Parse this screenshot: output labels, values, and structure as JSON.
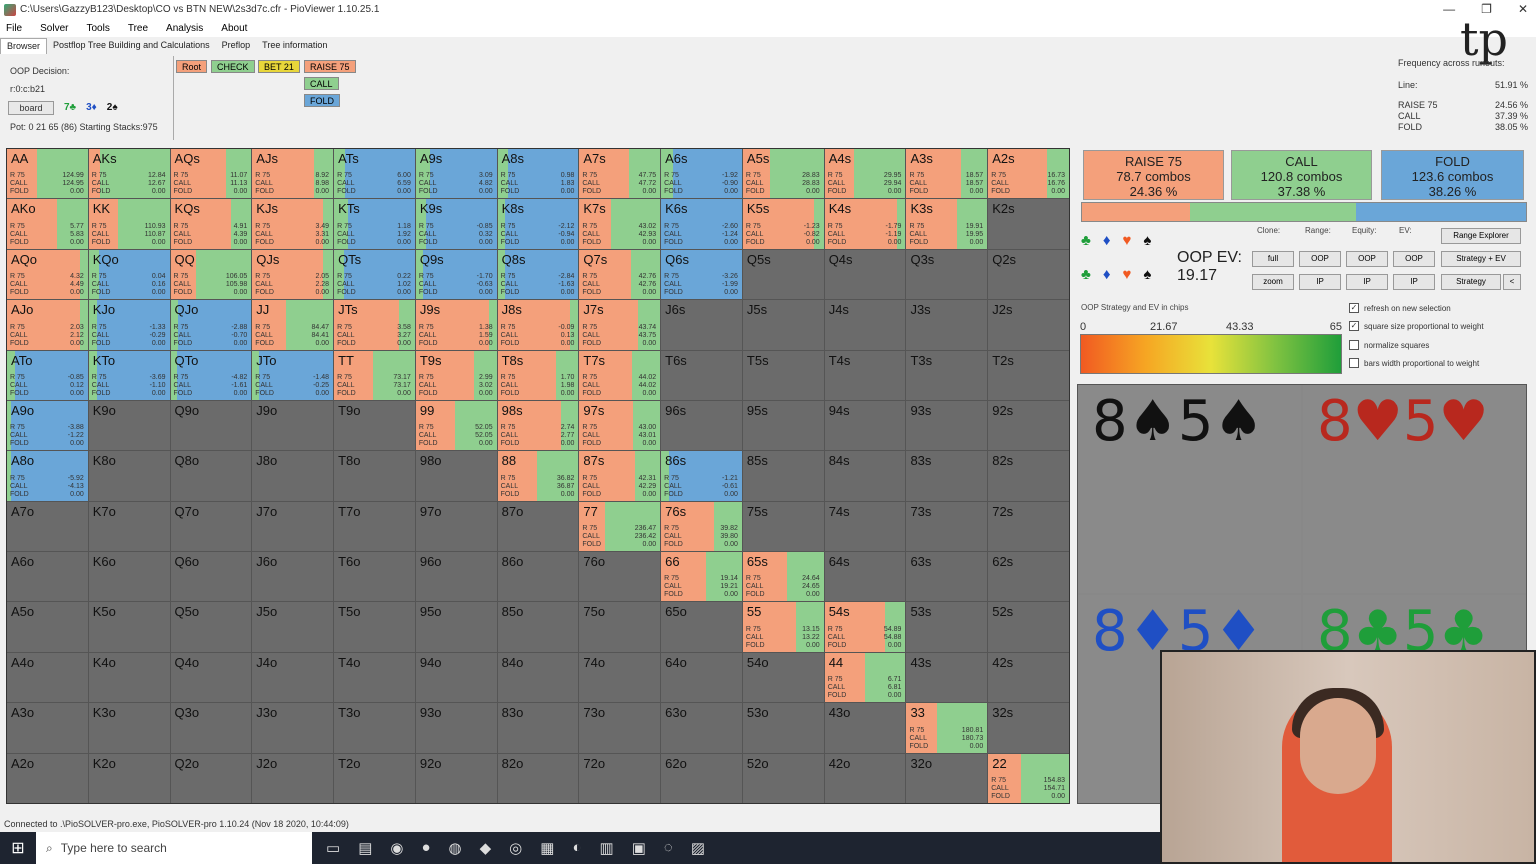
{
  "window": {
    "title": "C:\\Users\\GazzyB123\\Desktop\\CO vs BTN NEW\\2s3d7c.cfr - PioViewer 1.10.25.1"
  },
  "menu": [
    "File",
    "Solver",
    "Tools",
    "Tree",
    "Analysis",
    "About"
  ],
  "tabs": [
    "Browser",
    "Postflop Tree Building and Calculations",
    "Preflop",
    "Tree information"
  ],
  "info": {
    "decision": "OOP Decision:",
    "line": "r:0:c:b21",
    "board_btn": "board",
    "board_cards": [
      "7♣",
      "3♦",
      "2♠"
    ],
    "pot": "Pot: 0 21 65 (86) Starting Stacks:975"
  },
  "tree_actions": {
    "root": "Root",
    "check": "CHECK",
    "bet": "BET 21",
    "raise": "RAISE 75",
    "call": "CALL",
    "fold": "FOLD"
  },
  "freq": {
    "header": "Frequency across runouts:",
    "line_label": "Line:",
    "line_val": "51.91 %",
    "rows": [
      {
        "label": "RAISE 75",
        "val": "24.56 %"
      },
      {
        "label": "CALL",
        "val": "37.39 %"
      },
      {
        "label": "FOLD",
        "val": "38.05 %"
      }
    ]
  },
  "actions": {
    "raise": {
      "title": "RAISE 75",
      "combos": "78.7 combos",
      "pct": "24.36 %"
    },
    "call": {
      "title": "CALL",
      "combos": "120.8 combos",
      "pct": "37.38 %"
    },
    "fold": {
      "title": "FOLD",
      "combos": "123.6 combos",
      "pct": "38.26 %"
    }
  },
  "strategy_fracs": {
    "raise": 0.2436,
    "call": 0.3738,
    "fold": 0.3826
  },
  "oop_ev": {
    "label": "OOP EV:",
    "value": "19.17"
  },
  "controls": {
    "clone": "Clone:",
    "range": "Range:",
    "equity": "Equity:",
    "ev": "EV:",
    "full": "full",
    "zoom": "zoom",
    "oop": "OOP",
    "ip": "IP",
    "range_explorer": "Range Explorer",
    "strategy_ev": "Strategy + EV",
    "strategy": "Strategy",
    "arrow": "<"
  },
  "ev_label": "OOP Strategy and EV in chips",
  "ev_scale": [
    "0",
    "21.67",
    "43.33",
    "65"
  ],
  "checkboxes": [
    {
      "label": "refresh on new selection",
      "checked": true
    },
    {
      "label": "square size proportional to weight",
      "checked": true
    },
    {
      "label": "normalize squares",
      "checked": false
    },
    {
      "label": "bars width proportional to weight",
      "checked": false
    }
  ],
  "colors": {
    "raise": "#f4a07b",
    "call": "#8fcf8f",
    "fold": "#6aa6d8",
    "empty": "#6b6b6b"
  },
  "combos": [
    {
      "rank": "8",
      "suit": "♠",
      "color": "#111111"
    },
    {
      "rank": "8",
      "suit": "♥",
      "color": "#b8281e"
    },
    {
      "rank": "8",
      "suit": "♦",
      "color": "#1f4fc4"
    },
    {
      "rank": "8",
      "suit": "♣",
      "color": "#1f9e3a"
    }
  ],
  "combos_second": [
    "5♠",
    "5♥",
    "5♦",
    "5♣"
  ],
  "stat_labels": [
    "R 75",
    "CALL",
    "FOLD"
  ],
  "grid": [
    [
      [
        "AA",
        1,
        0.63,
        0,
        124.99,
        124.95
      ],
      [
        "AKs",
        1,
        0.86,
        0,
        12.84,
        12.67
      ],
      [
        "AQs",
        1,
        0.31,
        0,
        11.07,
        11.13
      ],
      [
        "AJs",
        1,
        0.24,
        0,
        8.92,
        8.98
      ],
      [
        "ATs",
        0,
        0.13,
        0,
        6.0,
        6.59
      ],
      [
        "A9s",
        0,
        0.18,
        0,
        3.09,
        4.82
      ],
      [
        "A8s",
        0,
        0.13,
        0,
        0.98,
        1.83
      ],
      [
        "A7s",
        1,
        0.38,
        0,
        47.75,
        47.72
      ],
      [
        "A6s",
        0,
        0.15,
        0,
        -1.92,
        -0.9
      ],
      [
        "A5s",
        1,
        0.67,
        0,
        28.83,
        28.83
      ],
      [
        "A4s",
        1,
        0.64,
        0,
        29.95,
        29.94
      ],
      [
        "A3s",
        1,
        0.32,
        0,
        18.57,
        18.57
      ],
      [
        "A2s",
        1,
        0.27,
        0,
        16.73,
        16.76
      ]
    ],
    [
      [
        "AKo",
        1,
        0.38,
        0,
        5.77,
        5.83
      ],
      [
        "KK",
        1,
        0.64,
        0,
        110.93,
        110.87
      ],
      [
        "KQs",
        1,
        0.25,
        0,
        4.91,
        4.39
      ],
      [
        "KJs",
        1,
        0.12,
        0,
        3.49,
        3.31
      ],
      [
        "KTs",
        0,
        0.17,
        0,
        1.18,
        1.92
      ],
      [
        "K9s",
        0,
        0.12,
        0,
        -0.85,
        0.32
      ],
      [
        "K8s",
        0,
        0.09,
        0,
        -2.12,
        -0.94
      ],
      [
        "K7s",
        1,
        0.61,
        0,
        43.02,
        42.93
      ],
      [
        "K6s",
        0,
        0,
        0,
        -2.6,
        -1.24
      ],
      [
        "K5s",
        1,
        0.12,
        0,
        -1.23,
        -0.82
      ],
      [
        "K4s",
        1,
        0.11,
        0,
        -1.79,
        -1.19
      ],
      [
        "K3s",
        1,
        0.37,
        0,
        19.91,
        19.95
      ],
      [
        "K2s",
        -1
      ]
    ],
    [
      [
        "AQo",
        1,
        0.1,
        0,
        4.32,
        4.49
      ],
      [
        "KQo",
        0,
        0.13,
        0,
        0.04,
        0.16
      ],
      [
        "QQ",
        1,
        0.68,
        0,
        106.05,
        105.98
      ],
      [
        "QJs",
        1,
        0.12,
        0,
        2.05,
        2.28
      ],
      [
        "QTs",
        0,
        0.12,
        0,
        0.22,
        1.02
      ],
      [
        "Q9s",
        0,
        0.09,
        0,
        -1.7,
        -0.63
      ],
      [
        "Q8s",
        0,
        0.09,
        0,
        -2.84,
        -1.63
      ],
      [
        "Q7s",
        1,
        0.36,
        0,
        42.76,
        42.76
      ],
      [
        "Q6s",
        0,
        0,
        0,
        -3.26,
        -1.99
      ],
      [
        "Q5s",
        -1
      ],
      [
        "Q4s",
        -1
      ],
      [
        "Q3s",
        -1
      ],
      [
        "Q2s",
        -1
      ]
    ],
    [
      [
        "AJo",
        1,
        0.1,
        0,
        2.03,
        2.12
      ],
      [
        "KJo",
        0,
        0.1,
        0,
        -1.33,
        -0.29
      ],
      [
        "QJo",
        0,
        0.09,
        0,
        -2.88,
        -0.7
      ],
      [
        "JJ",
        1,
        0.58,
        0,
        84.47,
        84.41
      ],
      [
        "JTs",
        1,
        0.2,
        0,
        3.58,
        3.27
      ],
      [
        "J9s",
        1,
        0.1,
        0,
        1.38,
        1.59
      ],
      [
        "J8s",
        1,
        0.1,
        0,
        -0.09,
        0.13
      ],
      [
        "J7s",
        1,
        0.28,
        0,
        43.74,
        43.75
      ],
      [
        "J6s",
        -1
      ],
      [
        "J5s",
        -1
      ],
      [
        "J4s",
        -1
      ],
      [
        "J3s",
        -1
      ],
      [
        "J2s",
        -1
      ]
    ],
    [
      [
        "ATo",
        0,
        0.1,
        0,
        -0.85,
        0.12
      ],
      [
        "KTo",
        0,
        0.1,
        0,
        -3.69,
        -1.1
      ],
      [
        "QTo",
        0,
        0.08,
        0,
        -4.82,
        -1.61
      ],
      [
        "JTo",
        0,
        0.08,
        0,
        -1.48,
        -0.25
      ],
      [
        "TT",
        1,
        0.52,
        0,
        73.17,
        73.17
      ],
      [
        "T9s",
        1,
        0.28,
        0,
        2.99,
        3.02
      ],
      [
        "T8s",
        1,
        0.28,
        0,
        1.7,
        1.98
      ],
      [
        "T7s",
        1,
        0.35,
        0,
        44.02,
        44.02
      ],
      [
        "T6s",
        -1
      ],
      [
        "T5s",
        -1
      ],
      [
        "T4s",
        -1
      ],
      [
        "T3s",
        -1
      ],
      [
        "T2s",
        -1
      ]
    ],
    [
      [
        "A9o",
        0,
        0.05,
        0,
        -3.88,
        -1.22
      ],
      [
        "K9o",
        -1
      ],
      [
        "Q9o",
        -1
      ],
      [
        "J9o",
        -1
      ],
      [
        "T9o",
        -1
      ],
      [
        "99",
        1,
        0.52,
        0,
        52.05,
        52.05
      ],
      [
        "98s",
        1,
        0.22,
        0,
        2.74,
        2.77
      ],
      [
        "97s",
        1,
        0.33,
        0,
        43.0,
        43.01
      ],
      [
        "96s",
        -1
      ],
      [
        "95s",
        -1
      ],
      [
        "94s",
        -1
      ],
      [
        "93s",
        -1
      ],
      [
        "92s",
        -1
      ]
    ],
    [
      [
        "A8o",
        0,
        0.05,
        0,
        -5.92,
        -4.13
      ],
      [
        "K8o",
        -1
      ],
      [
        "Q8o",
        -1
      ],
      [
        "J8o",
        -1
      ],
      [
        "T8o",
        -1
      ],
      [
        "98o",
        -1
      ],
      [
        "88",
        1,
        0.51,
        0,
        36.82,
        36.87
      ],
      [
        "87s",
        1,
        0.31,
        0,
        42.31,
        42.29
      ],
      [
        "86s",
        0,
        0.1,
        0,
        -1.21,
        -0.61
      ],
      [
        "85s",
        -1
      ],
      [
        "84s",
        -1
      ],
      [
        "83s",
        -1
      ],
      [
        "82s",
        -1
      ]
    ],
    [
      [
        "A7o",
        -1
      ],
      [
        "K7o",
        -1
      ],
      [
        "Q7o",
        -1
      ],
      [
        "J7o",
        -1
      ],
      [
        "T7o",
        -1
      ],
      [
        "97o",
        -1
      ],
      [
        "87o",
        -1
      ],
      [
        "77",
        1,
        0.68,
        0,
        236.47,
        236.42
      ],
      [
        "76s",
        1,
        0.34,
        0,
        39.82,
        39.8
      ],
      [
        "75s",
        -1
      ],
      [
        "74s",
        -1
      ],
      [
        "73s",
        -1
      ],
      [
        "72s",
        -1
      ]
    ],
    [
      [
        "A6o",
        -1
      ],
      [
        "K6o",
        -1
      ],
      [
        "Q6o",
        -1
      ],
      [
        "J6o",
        -1
      ],
      [
        "T6o",
        -1
      ],
      [
        "96o",
        -1
      ],
      [
        "86o",
        -1
      ],
      [
        "76o",
        -1
      ],
      [
        "66",
        1,
        0.44,
        0,
        19.14,
        19.21
      ],
      [
        "65s",
        1,
        0.45,
        0,
        24.64,
        24.65
      ],
      [
        "64s",
        -1
      ],
      [
        "63s",
        -1
      ],
      [
        "62s",
        -1
      ]
    ],
    [
      [
        "A5o",
        -1
      ],
      [
        "K5o",
        -1
      ],
      [
        "Q5o",
        -1
      ],
      [
        "J5o",
        -1
      ],
      [
        "T5o",
        -1
      ],
      [
        "95o",
        -1
      ],
      [
        "85o",
        -1
      ],
      [
        "75o",
        -1
      ],
      [
        "65o",
        -1
      ],
      [
        "55",
        1,
        0.34,
        0,
        13.15,
        13.22
      ],
      [
        "54s",
        1,
        0.25,
        0,
        54.89,
        54.88
      ],
      [
        "53s",
        -1
      ],
      [
        "52s",
        -1
      ]
    ],
    [
      [
        "A4o",
        -1
      ],
      [
        "K4o",
        -1
      ],
      [
        "Q4o",
        -1
      ],
      [
        "J4o",
        -1
      ],
      [
        "T4o",
        -1
      ],
      [
        "94o",
        -1
      ],
      [
        "84o",
        -1
      ],
      [
        "74o",
        -1
      ],
      [
        "64o",
        -1
      ],
      [
        "54o",
        -1
      ],
      [
        "44",
        1,
        0.5,
        0,
        6.71,
        6.81
      ],
      [
        "43s",
        -1
      ],
      [
        "42s",
        -1
      ]
    ],
    [
      [
        "A3o",
        -1
      ],
      [
        "K3o",
        -1
      ],
      [
        "Q3o",
        -1
      ],
      [
        "J3o",
        -1
      ],
      [
        "T3o",
        -1
      ],
      [
        "93o",
        -1
      ],
      [
        "83o",
        -1
      ],
      [
        "73o",
        -1
      ],
      [
        "63o",
        -1
      ],
      [
        "53o",
        -1
      ],
      [
        "43o",
        -1
      ],
      [
        "33",
        1,
        0.62,
        0,
        180.81,
        180.73
      ],
      [
        "32s",
        -1
      ]
    ],
    [
      [
        "A2o",
        -1
      ],
      [
        "K2o",
        -1
      ],
      [
        "Q2o",
        -1
      ],
      [
        "J2o",
        -1
      ],
      [
        "T2o",
        -1
      ],
      [
        "92o",
        -1
      ],
      [
        "82o",
        -1
      ],
      [
        "72o",
        -1
      ],
      [
        "62o",
        -1
      ],
      [
        "52o",
        -1
      ],
      [
        "42o",
        -1
      ],
      [
        "32o",
        -1
      ],
      [
        "22",
        1,
        0.6,
        0,
        154.83,
        154.71
      ]
    ]
  ],
  "status": "Connected to .\\PioSOLVER-pro.exe, PioSOLVER-pro 1.10.24 (Nov 18 2020, 10:44:09)",
  "taskbar": {
    "search": "Type here to search"
  }
}
